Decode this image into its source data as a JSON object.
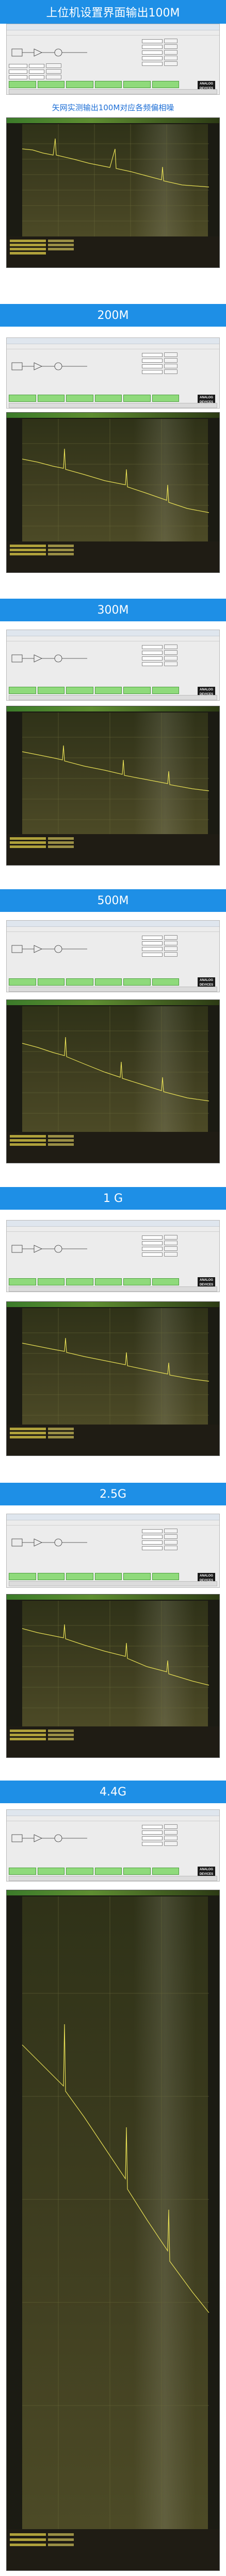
{
  "header_title": "上位机设置界面输出100M",
  "caption_spectrum": "矢网实测输出100M对应各频偏相噪",
  "sections": [
    {
      "id": "s200",
      "label": "200M"
    },
    {
      "id": "s300",
      "label": "300M"
    },
    {
      "id": "s500",
      "label": "500M"
    },
    {
      "id": "s1g",
      "label": "1 G"
    },
    {
      "id": "s25g",
      "label": "2.5G"
    },
    {
      "id": "s44g",
      "label": "4.4G"
    }
  ],
  "software": {
    "logo_text": "ANALOG DEVICES"
  },
  "colors": {
    "band_blue": "#1e8fe6",
    "caption_blue": "#1e6fd6",
    "trace_yellow": "#e6de55",
    "status_green": "#7ed36c"
  }
}
